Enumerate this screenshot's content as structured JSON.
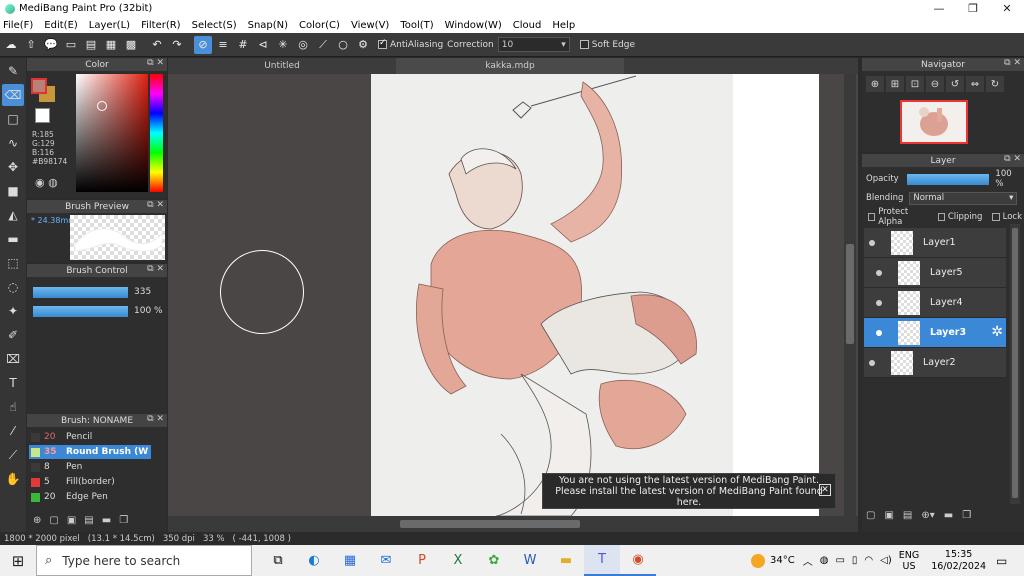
{
  "window": {
    "title": "MediBang Paint Pro (32bit)",
    "controls": [
      "—",
      "❐",
      "✕"
    ]
  },
  "menu": [
    "File(F)",
    "Edit(E)",
    "Layer(L)",
    "Filter(R)",
    "Select(S)",
    "Snap(N)",
    "Color(C)",
    "View(V)",
    "Tool(T)",
    "Window(W)",
    "Cloud",
    "Help"
  ],
  "toolbar": {
    "antialiasing_label": "AntiAliasing",
    "correction_label": "Correction",
    "correction_value": "10",
    "soft_edge_label": "Soft Edge"
  },
  "color_panel": {
    "title": "Color",
    "r": "R:185",
    "g": "G:129",
    "b": "B:116",
    "hex": "#B98174",
    "foreground": "#B98174"
  },
  "brush_preview": {
    "title": "Brush Preview",
    "size": "* 24.38mm"
  },
  "brush_control": {
    "title": "Brush Control",
    "size_value": "335",
    "opacity_value": "100 %"
  },
  "brush_list": {
    "title": "Brush: NONAME",
    "items": [
      {
        "size": "20",
        "name": "Pencil",
        "color": "#3a3a3a"
      },
      {
        "size": "35",
        "name": "Round Brush (W",
        "color": "#c8e68a"
      },
      {
        "size": "8",
        "name": "Pen",
        "color": "#3a3a3a"
      },
      {
        "size": "5",
        "name": "Fill(border)",
        "color": "#e03a3a"
      },
      {
        "size": "20",
        "name": "Edge Pen",
        "color": "#3ab83a"
      }
    ]
  },
  "document_tabs": [
    "Untitled",
    "kakka.mdp"
  ],
  "notice": {
    "line1": "You are not using the latest version of MediBang Paint.",
    "line2": "Please install the latest version of MediBang Paint found here."
  },
  "navigator": {
    "title": "Navigator"
  },
  "layer_panel": {
    "title": "Layer",
    "opacity_label": "Opacity",
    "opacity_value": "100 %",
    "blending_label": "Blending",
    "blending_value": "Normal",
    "protect_alpha": "Protect Alpha",
    "clipping": "Clipping",
    "lock": "Lock",
    "layers": [
      {
        "name": "Layer1"
      },
      {
        "name": "Layer5"
      },
      {
        "name": "Layer4"
      },
      {
        "name": "Layer3"
      },
      {
        "name": "Layer2"
      }
    ]
  },
  "status": {
    "size": "1800 * 2000 pixel",
    "cm": "(13.1 * 14.5cm)",
    "dpi": "350 dpi",
    "zoom": "33 %",
    "coords": "( -441, 1008 )"
  },
  "taskbar": {
    "search_placeholder": "Type here to search",
    "temperature": "34°C",
    "lang1": "ENG",
    "lang2": "US",
    "time": "15:35",
    "date": "16/02/2024"
  }
}
